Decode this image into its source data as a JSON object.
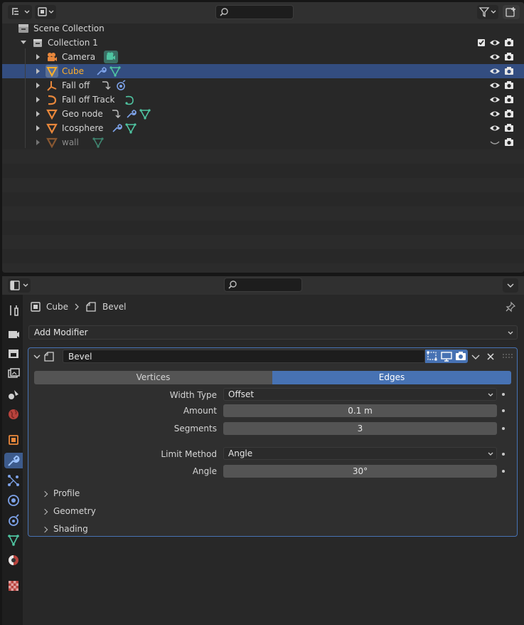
{
  "outliner": {
    "search": {
      "placeholder": ""
    },
    "rows": [
      {
        "label": "Scene Collection"
      },
      {
        "label": "Collection 1"
      },
      {
        "label": "Camera"
      },
      {
        "label": "Cube"
      },
      {
        "label": "Fall off"
      },
      {
        "label": "Fall off Track"
      },
      {
        "label": "Geo node"
      },
      {
        "label": "Icosphere"
      },
      {
        "label": "wall"
      }
    ]
  },
  "properties": {
    "search": {
      "placeholder": ""
    },
    "breadcrumb": {
      "object": "Cube",
      "modifier": "Bevel"
    },
    "add_modifier": "Add Modifier",
    "modifier": {
      "name": "Bevel",
      "affect_tabs": [
        "Vertices",
        "Edges"
      ],
      "active_tab": "Edges",
      "fields": {
        "width_type": {
          "label": "Width Type",
          "value": "Offset"
        },
        "amount": {
          "label": "Amount",
          "value": "0.1 m"
        },
        "segments": {
          "label": "Segments",
          "value": "3"
        },
        "limit_method": {
          "label": "Limit Method",
          "value": "Angle"
        },
        "angle": {
          "label": "Angle",
          "value": "30°"
        }
      },
      "subpanels": [
        "Profile",
        "Geometry",
        "Shading"
      ]
    }
  },
  "colors": {
    "selection": "#334d80",
    "active_orange": "#ffaf29",
    "object_orange": "#e8873b",
    "data_green": "#4fc4a1",
    "modifier_blue": "#7da2e8",
    "accent_blue": "#4772b3"
  }
}
